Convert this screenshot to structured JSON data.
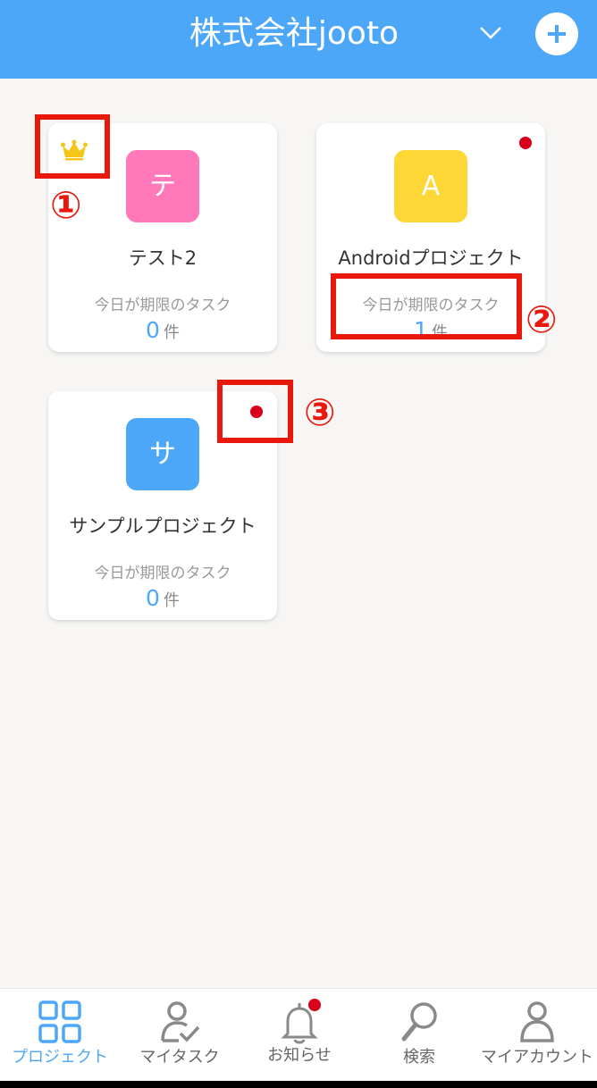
{
  "header": {
    "title": "株式会社jooto"
  },
  "projects": [
    {
      "name": "テスト2",
      "tile_char": "テ",
      "tile_color": "#ff78b9",
      "due_label": "今日が期限のタスク",
      "due_count": "0",
      "due_unit": "件",
      "favorite": true,
      "unread": false
    },
    {
      "name": "Androidプロジェクト",
      "tile_char": "A",
      "tile_color": "#fdd735",
      "due_label": "今日が期限のタスク",
      "due_count": "1",
      "due_unit": "件",
      "favorite": false,
      "unread": true
    },
    {
      "name": "サンプルプロジェクト",
      "tile_char": "サ",
      "tile_color": "#4da7f8",
      "due_label": "今日が期限のタスク",
      "due_count": "0",
      "due_unit": "件",
      "favorite": false,
      "unread": true
    }
  ],
  "annotations": [
    "①",
    "②",
    "③"
  ],
  "tabs": [
    {
      "label": "プロジェクト",
      "icon": "grid-icon",
      "active": true
    },
    {
      "label": "マイタスク",
      "icon": "user-check-icon",
      "active": false
    },
    {
      "label": "お知らせ",
      "icon": "bell-icon",
      "active": false,
      "badge": true
    },
    {
      "label": "検索",
      "icon": "search-icon",
      "active": false
    },
    {
      "label": "マイアカウント",
      "icon": "person-icon",
      "active": false
    }
  ],
  "colors": {
    "accent": "#4da7f8",
    "badge": "#d9001b",
    "annotation": "#e8180c",
    "crown": "#f5c518"
  }
}
